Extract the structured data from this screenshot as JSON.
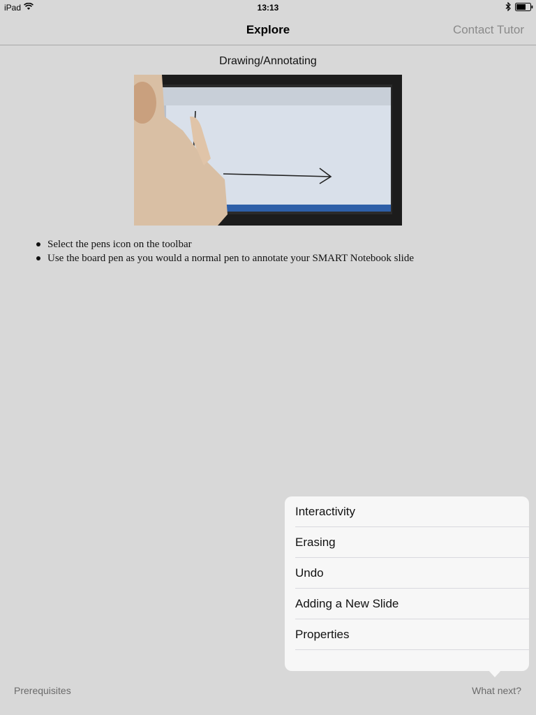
{
  "status_bar": {
    "device": "iPad",
    "time": "13:13",
    "icons": [
      "wifi-icon",
      "bluetooth-icon",
      "battery-icon"
    ]
  },
  "nav": {
    "title": "Explore",
    "right_button": "Contact Tutor"
  },
  "content": {
    "title": "Drawing/Annotating",
    "video_description": "Man drawing an arrow on a SMART Board with a pen",
    "bullets": [
      "Select the pens icon on the toolbar",
      "Use the board pen as you would a normal pen to annotate your SMART Notebook slide"
    ]
  },
  "popover": {
    "items": [
      "Interactivity",
      "Erasing",
      "Undo",
      "Adding a New Slide",
      "Properties"
    ]
  },
  "footer": {
    "left": "Prerequisites",
    "right": "What next?"
  }
}
